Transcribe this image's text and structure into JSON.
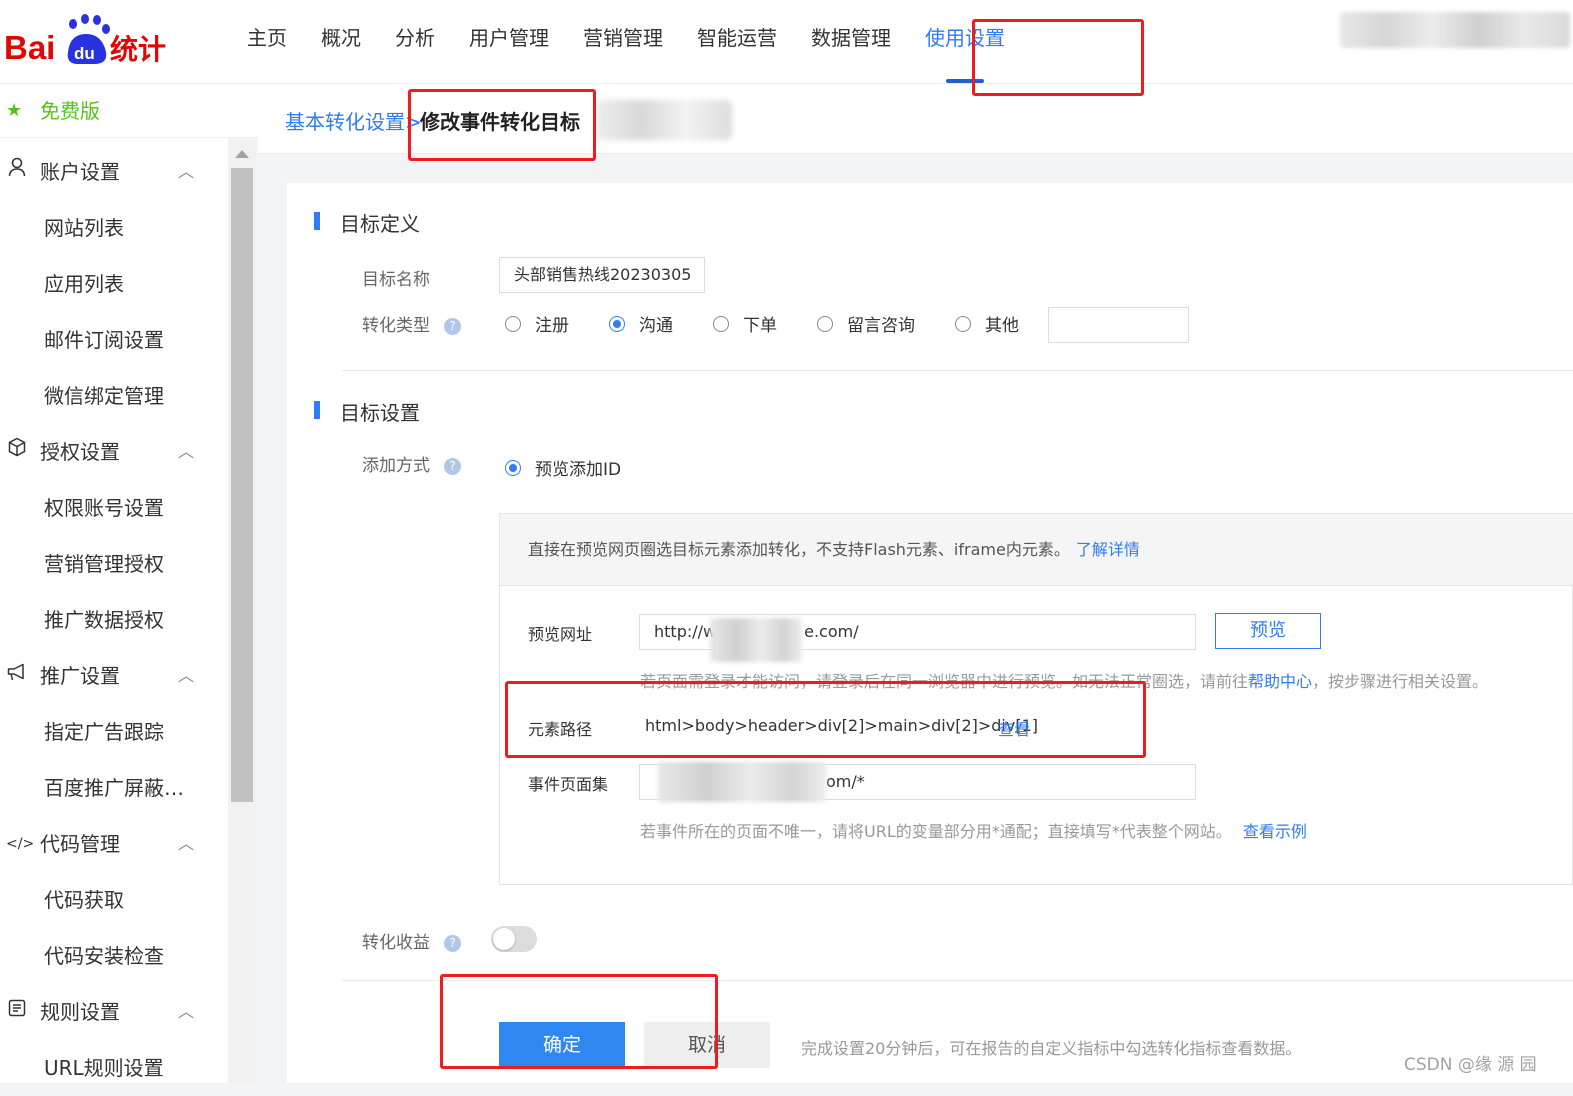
{
  "logo": {
    "text_bai": "Bai",
    "text_du": "du",
    "text_tongji": "统计"
  },
  "nav": [
    "主页",
    "概况",
    "分析",
    "用户管理",
    "营销管理",
    "智能运营",
    "数据管理",
    "使用设置"
  ],
  "nav_active_index": 7,
  "sidebar": {
    "edition": "免费版",
    "groups": [
      {
        "label": "账户设置",
        "icon": "user-icon",
        "items": [
          "网站列表",
          "应用列表",
          "邮件订阅设置",
          "微信绑定管理"
        ]
      },
      {
        "label": "授权设置",
        "icon": "cube-icon",
        "items": [
          "权限账号设置",
          "营销管理授权",
          "推广数据授权"
        ]
      },
      {
        "label": "推广设置",
        "icon": "megaphone-icon",
        "items": [
          "指定广告跟踪",
          "百度推广屏蔽…"
        ]
      },
      {
        "label": "代码管理",
        "icon": "code-icon",
        "items": [
          "代码获取",
          "代码安装检查"
        ]
      },
      {
        "label": "规则设置",
        "icon": "rules-icon",
        "items": [
          "URL规则设置"
        ]
      }
    ]
  },
  "breadcrumb": {
    "parent": "基本转化设置",
    "separator": ">",
    "current": "修改事件转化目标"
  },
  "target_def": {
    "section_title": "目标定义",
    "name_label": "目标名称",
    "name_value": "头部销售热线20230305",
    "type_label": "转化类型",
    "type_options": [
      "注册",
      "沟通",
      "下单",
      "留言咨询",
      "其他"
    ],
    "type_selected_index": 1
  },
  "target_set": {
    "section_title": "目标设置",
    "method_label": "添加方式",
    "method_option": "预览添加ID",
    "panel_desc": "直接在预览网页圈选目标元素添加转化，不支持Flash元素、iframe内元素。",
    "panel_link": "了解详情",
    "preview_url_label": "预览网址",
    "preview_url_value_start": "http://w",
    "preview_url_value_end": "e.com/",
    "preview_button": "预览",
    "login_hint": "若页面需登录才能访问，请登录后在同一浏览器中进行预览。如无法正常圈选，请前往",
    "login_hint_link": "帮助中心",
    "login_hint_tail": "，按步骤进行相关设置。",
    "element_path_label": "元素路径",
    "element_path_value": "html>body>header>div[2]>main>div[2]>div[1]",
    "element_path_link": "查看",
    "pageset_label": "事件页面集",
    "pageset_value_end": "om/*",
    "pageset_hint": "若事件所在的页面不唯一，请将URL的变量部分用*通配；直接填写*代表整个网站。",
    "pageset_hint_link": "查看示例",
    "revenue_label": "转化收益",
    "revenue_enabled": false
  },
  "footer": {
    "confirm": "确定",
    "cancel": "取消",
    "note": "完成设置20分钟后，可在报告的自定义指标中勾选转化指标查看数据。"
  },
  "watermark": "CSDN @缘  源  园",
  "colors": {
    "accent": "#2f7cf4",
    "highlight_box": "#ee1d1d",
    "free_green": "#52c41a"
  }
}
